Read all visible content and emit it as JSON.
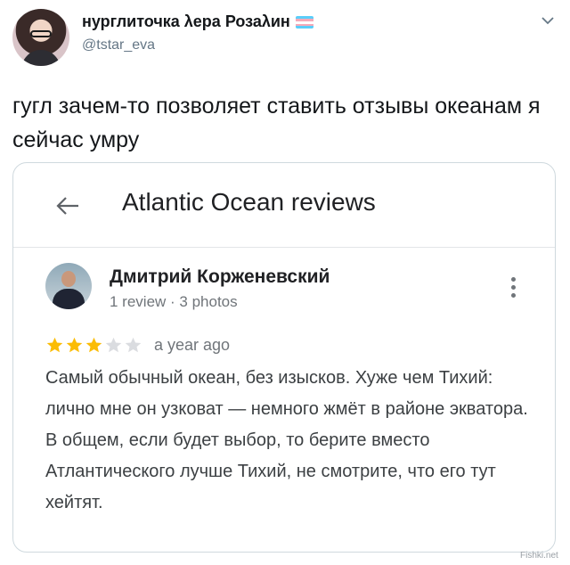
{
  "tweet": {
    "display_name": "нурглиточка λера Розаλин",
    "handle": "@tstar_eva",
    "text": "гугл зачем-то позволяет ставить отзывы океанам я сейчас умру",
    "flag_colors": [
      "#5bcefa",
      "#f5a9b8",
      "#ffffff",
      "#f5a9b8",
      "#5bcefa"
    ],
    "icons": {
      "avatar": "user-avatar",
      "menu": "chevron-down-icon"
    }
  },
  "card": {
    "title": "Atlantic Ocean reviews",
    "back_icon": "arrow-left-icon",
    "review": {
      "reviewer_name": "Дмитрий Корженевский",
      "reviewer_meta": "1 review · 3 photos",
      "rating": 3,
      "rating_max": 5,
      "star_color": "#fbbc04",
      "date": "a year ago",
      "text": "Самый обычный океан, без изысков. Хуже чем Тихий: лично мне он узковат — немного жмёт в районе экватора. В общем, если будет выбор, то берите вместо Атлантического лучше Тихий, не смотрите, что его тут хейтят.",
      "menu_icon": "more-vertical-icon"
    }
  },
  "watermark": "Fishki.net"
}
